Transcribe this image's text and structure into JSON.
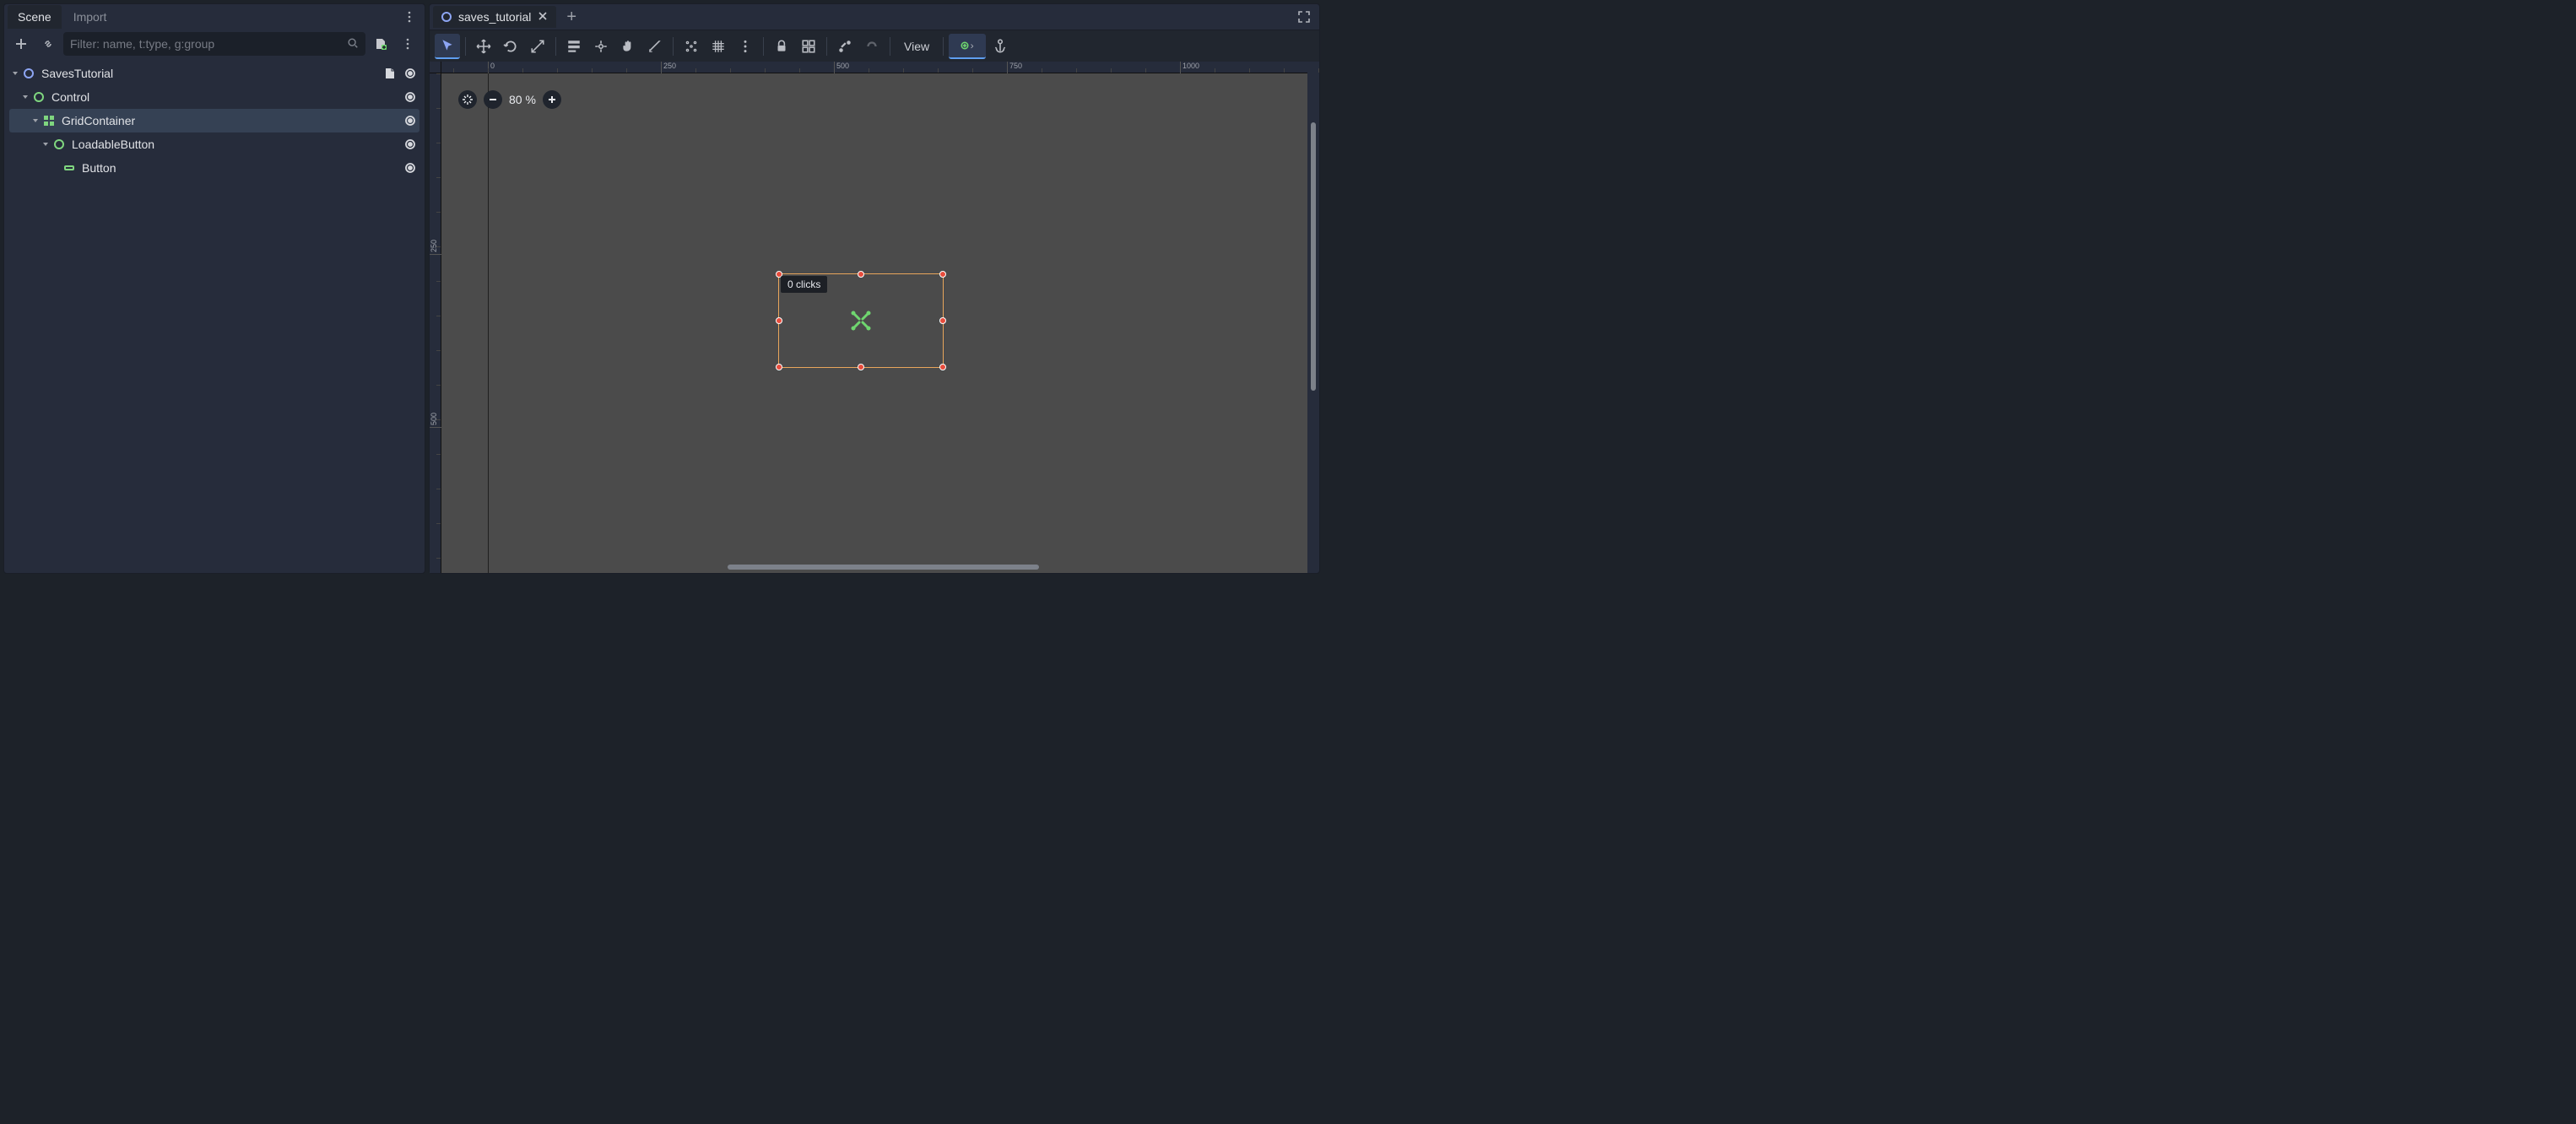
{
  "left": {
    "tabs": {
      "scene": "Scene",
      "import": "Import"
    },
    "filter_placeholder": "Filter: name, t:type, g:group",
    "tree": [
      {
        "name": "SavesTutorial",
        "indent": 0,
        "icon": "circle-blue",
        "script": true,
        "vis": true,
        "expanded": true,
        "selected": false
      },
      {
        "name": "Control",
        "indent": 1,
        "icon": "circle-green",
        "script": false,
        "vis": true,
        "expanded": true,
        "selected": false
      },
      {
        "name": "GridContainer",
        "indent": 2,
        "icon": "grid-green",
        "script": false,
        "vis": true,
        "expanded": true,
        "selected": true
      },
      {
        "name": "LoadableButton",
        "indent": 3,
        "icon": "circle-green",
        "script": false,
        "vis": true,
        "expanded": true,
        "selected": false
      },
      {
        "name": "Button",
        "indent": 4,
        "icon": "button-green",
        "script": false,
        "vis": true,
        "expanded": false,
        "selected": false
      }
    ]
  },
  "right": {
    "doc_tab": "saves_tutorial",
    "view_label": "View",
    "zoom_label": "80 %",
    "tooltip": "0 clicks",
    "ruler_h": [
      "0",
      "250",
      "500",
      "750",
      "1000"
    ],
    "ruler_v": [
      "250",
      "500"
    ]
  }
}
